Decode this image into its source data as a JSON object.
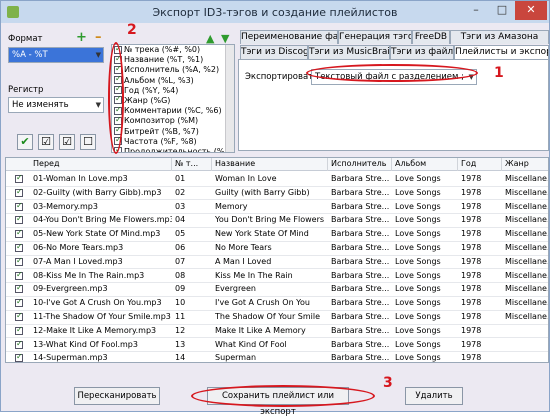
{
  "window": {
    "title": "Экспорт ID3-тэгов и создание плейлистов",
    "minimize": "–",
    "maximize": "□",
    "close": "✕"
  },
  "left": {
    "format_label": "Формат",
    "format_value": "%A - %T",
    "case_label": "Регистр",
    "case_value": "Не изменять",
    "add_icon": "+",
    "remove_icon": "–"
  },
  "fields": [
    {
      "label": "№ трека (%#, %0)",
      "checked": true
    },
    {
      "label": "Название (%T, %1)",
      "checked": true
    },
    {
      "label": "Исполнитель (%A, %2)",
      "checked": true
    },
    {
      "label": "Альбом (%L, %3)",
      "checked": true
    },
    {
      "label": "Год (%Y, %4)",
      "checked": true
    },
    {
      "label": "Жанр (%G)",
      "checked": true
    },
    {
      "label": "Комментарии (%C, %6)",
      "checked": true
    },
    {
      "label": "Композитор (%M)",
      "checked": true
    },
    {
      "label": "Битрейт (%B, %7)",
      "checked": true
    },
    {
      "label": "Частота (%F, %8)",
      "checked": true
    },
    {
      "label": "Продолжительность (%L",
      "checked": true
    }
  ],
  "tabs_row1": [
    "Переименование файлы",
    "Генерация тэгов",
    "FreeDB",
    "Тэги из Амазона"
  ],
  "tabs_row2": [
    "Тэги из Discogs",
    "Тэги из MusicBrainz",
    "Тэги из файла",
    "Плейлисты и экспорт"
  ],
  "panel": {
    "export_label": "Экспортировать",
    "export_value": "Текстовый файл с разделением ;"
  },
  "table": {
    "headers": [
      "Перед",
      "№ т...",
      "Название",
      "Исполнитель",
      "Альбом",
      "Год",
      "Жанр"
    ],
    "rows": [
      {
        "file": "01-Woman In Love.mp3",
        "num": "01",
        "title": "Woman In Love",
        "artist": "Barbara Stre...",
        "album": "Love Songs",
        "year": "1978",
        "genre": "Miscellane..."
      },
      {
        "file": "02-Guilty (with Barry Gibb).mp3",
        "num": "02",
        "title": "Guilty (with Barry Gibb)",
        "artist": "Barbara Stre...",
        "album": "Love Songs",
        "year": "1978",
        "genre": "Miscellane..."
      },
      {
        "file": "03-Memory.mp3",
        "num": "03",
        "title": "Memory",
        "artist": "Barbara Stre...",
        "album": "Love Songs",
        "year": "1978",
        "genre": "Miscellane..."
      },
      {
        "file": "04-You Don't Bring Me Flowers.mp3",
        "num": "04",
        "title": "You Don't Bring Me Flowers",
        "artist": "Barbara Stre...",
        "album": "Love Songs",
        "year": "1978",
        "genre": "Miscellane..."
      },
      {
        "file": "05-New York State Of Mind.mp3",
        "num": "05",
        "title": "New York State Of Mind",
        "artist": "Barbara Stre...",
        "album": "Love Songs",
        "year": "1978",
        "genre": "Miscellane..."
      },
      {
        "file": "06-No More Tears.mp3",
        "num": "06",
        "title": "No More Tears",
        "artist": "Barbara Stre...",
        "album": "Love Songs",
        "year": "1978",
        "genre": "Miscellane..."
      },
      {
        "file": "07-A Man I Loved.mp3",
        "num": "07",
        "title": "A Man I Loved",
        "artist": "Barbara Stre...",
        "album": "Love Songs",
        "year": "1978",
        "genre": "Miscellane..."
      },
      {
        "file": "08-Kiss Me In The Rain.mp3",
        "num": "08",
        "title": "Kiss Me In The Rain",
        "artist": "Barbara Stre...",
        "album": "Love Songs",
        "year": "1978",
        "genre": "Miscellane..."
      },
      {
        "file": "09-Evergreen.mp3",
        "num": "09",
        "title": "Evergreen",
        "artist": "Barbara Stre...",
        "album": "Love Songs",
        "year": "1978",
        "genre": "Miscellane..."
      },
      {
        "file": "10-I've Got A Crush On You.mp3",
        "num": "10",
        "title": "I've Got A Crush On You",
        "artist": "Barbara Stre...",
        "album": "Love Songs",
        "year": "1978",
        "genre": "Miscellane..."
      },
      {
        "file": "11-The Shadow Of Your Smile.mp3",
        "num": "11",
        "title": "The Shadow Of Your Smile",
        "artist": "Barbara Stre...",
        "album": "Love Songs",
        "year": "1978",
        "genre": "Miscellane..."
      },
      {
        "file": "12-Make It Like A Memory.mp3",
        "num": "12",
        "title": "Make It Like A Memory",
        "artist": "Barbara Stre...",
        "album": "Love Songs",
        "year": "1978",
        "genre": ""
      },
      {
        "file": "13-What Kind Of Fool.mp3",
        "num": "13",
        "title": "What Kind Of Fool",
        "artist": "Barbara Stre...",
        "album": "Love Songs",
        "year": "1978",
        "genre": ""
      },
      {
        "file": "14-Superman.mp3",
        "num": "14",
        "title": "Superman",
        "artist": "Barbara Stre...",
        "album": "Love Songs",
        "year": "1978",
        "genre": ""
      }
    ]
  },
  "buttons": {
    "rescan": "Пересканировать",
    "save": "Сохранить плейлист или экспорт",
    "delete": "Удалить"
  },
  "annotations": [
    "1",
    "2",
    "3"
  ],
  "colors": {
    "accent_red": "#d6171e",
    "selection_blue": "#3b74d9",
    "check_green": "#1a6e1a"
  }
}
